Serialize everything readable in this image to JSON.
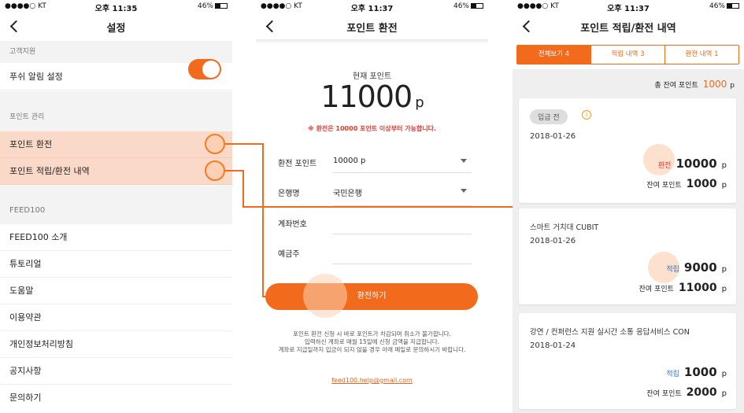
{
  "screen1": {
    "status": {
      "carrier": "●●●●○ KT",
      "time": "오후 11:35",
      "battery": "46%"
    },
    "nav": {
      "title": "설정"
    },
    "section_support": "고객지원",
    "push_label": "푸쉬 알림 설정",
    "push_on": true,
    "section_points": "포인트 관리",
    "points_exchange": "포인트 환전",
    "points_history": "포인트 적립/환전 내역",
    "section_feed": "FEED100",
    "menu": [
      "FEED100 소개",
      "튜토리얼",
      "도움말",
      "이용약관",
      "개인정보처리방침",
      "공지사항",
      "문의하기"
    ]
  },
  "screen2": {
    "status": {
      "carrier": "●●●●○ KT",
      "time": "오후 11:37",
      "battery": "46%"
    },
    "nav": {
      "title": "포인트 환전"
    },
    "current_label": "현재 포인트",
    "current_value": "11000",
    "unit": "p",
    "warning": "※ 환전은 10000 포인트 이상부터 가능합니다.",
    "fields": {
      "amount_label": "환전 포인트",
      "amount_value": "10000 p",
      "bank_label": "은행명",
      "bank_value": "국민은행",
      "account_label": "계좌번호",
      "account_value": "",
      "holder_label": "예금주",
      "holder_value": ""
    },
    "button": "환전하기",
    "notice_1": "포인트 환전 신청 시 바로 포인트가 차감되며 취소가 불가합니다.",
    "notice_2": "입력하신 계좌로 매월 15일에 신청 금액을 지급합니다.",
    "notice_3": "계좌로 지급일까지 입금이 되지 않을 경우 아래 메일로 문의하시기 바랍니다.",
    "email": "feed100.help@gmail.com"
  },
  "screen3": {
    "status": {
      "carrier": "●●●●○ KT",
      "time": "오후 11:37",
      "battery": "46%"
    },
    "nav": {
      "title": "포인트 적립/환전 내역"
    },
    "tabs": [
      "전체보기 4",
      "적립 내역 3",
      "환전 내역 1"
    ],
    "active_tab": 0,
    "total_label": "총 잔여 포인트",
    "total_value": "1000",
    "unit": "p",
    "cards": [
      {
        "badge": "입금 전",
        "title": "",
        "date": "2018-01-26",
        "type": "환전",
        "amount": "10000",
        "balance_label": "잔여 포인트",
        "balance": "1000"
      },
      {
        "badge": "",
        "title": "스마트 거치대 CUBIT",
        "date": "2018-01-26",
        "type": "적립",
        "amount": "9000",
        "balance_label": "잔여 포인트",
        "balance": "11000"
      },
      {
        "badge": "",
        "title": "강연 / 컨퍼런스 지원 실시간 소통 응답서비스 CON",
        "date": "2018-01-24",
        "type": "적립",
        "amount": "1000",
        "balance_label": "잔여 포인트",
        "balance": "2000"
      }
    ]
  },
  "colors": {
    "accent": "#f26b1d",
    "highlight": "#fbd9c8",
    "exchange": "#e23b2e",
    "accrual": "#2a6fd6"
  }
}
